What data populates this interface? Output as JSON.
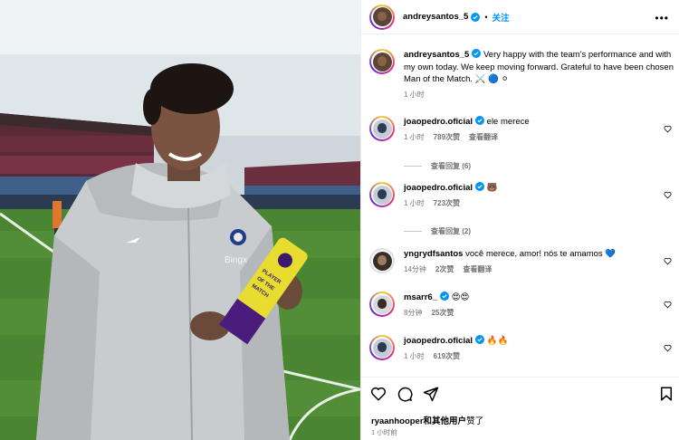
{
  "post": {
    "author": "andreysantos_5",
    "follow_label": "关注",
    "dot": "•",
    "more_label": "•••",
    "photo_labels": {
      "sponsor": "Bingx",
      "trophy_line1": "PLAYER",
      "trophy_line2": "OF THE",
      "trophy_line3": "MATCH"
    }
  },
  "caption": {
    "author": "andreysantos_5",
    "text": "Very happy with the team's performance and with my own today. We keep moving forward. Grateful to have been chosen Man of the Match. ⚔️ 🔵 ⚪",
    "time": "1 小时"
  },
  "comments": [
    {
      "author": "joaopedro.oficial",
      "text": "ele merece",
      "time": "1 小时",
      "likes": "789次赞",
      "translate": "查看翻译",
      "replies": "查看回复 (6)"
    },
    {
      "author": "joaopedro.oficial",
      "text": "🐻",
      "time": "1 小时",
      "likes": "723次赞",
      "translate": "",
      "replies": "查看回复 (2)"
    },
    {
      "author": "yngrydfsantos",
      "text": "você merece, amor! nós te amamos 💙",
      "time": "14分钟",
      "likes": "2次赞",
      "translate": "查看翻译",
      "replies": ""
    },
    {
      "author": "msarr6_",
      "text": "😍😍",
      "time": "8分钟",
      "likes": "25次赞",
      "translate": "",
      "replies": ""
    },
    {
      "author": "joaopedro.oficial",
      "text": "🔥🔥",
      "time": "1 小时",
      "likes": "619次赞",
      "translate": "",
      "replies": ""
    }
  ],
  "footer": {
    "liked_by_user": "ryaanhooper",
    "liked_by_rest": "和其他用户",
    "liked_suffix": "赞了",
    "time_ago": "1 小时前"
  },
  "colors": {
    "link": "#0095f6",
    "muted": "#737373",
    "verified": "#0095f6"
  }
}
